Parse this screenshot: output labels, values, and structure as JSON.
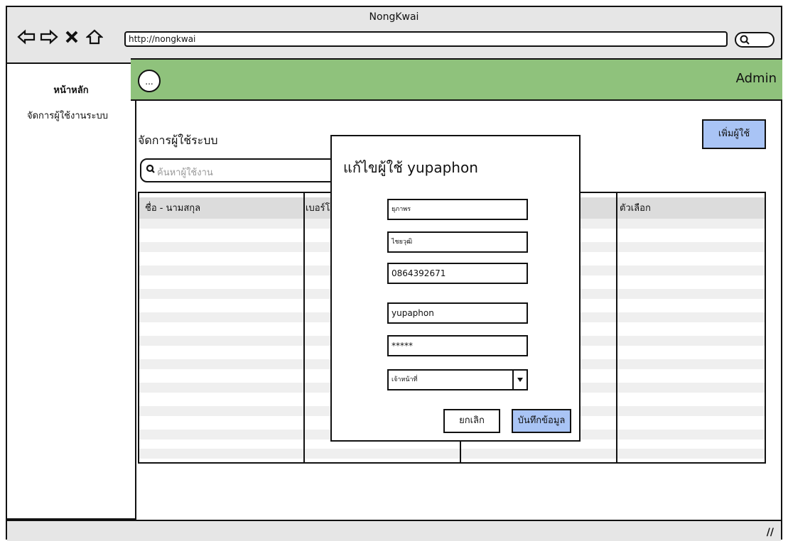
{
  "window": {
    "title": "NongKwai"
  },
  "browser": {
    "url": "http://nongkwai"
  },
  "sidebar": {
    "items": [
      {
        "label": "หน้าหลัก"
      },
      {
        "label": "จัดการผู้ใช้งานระบบ"
      }
    ]
  },
  "topbar": {
    "menu_label": "...",
    "user": "Admin",
    "color": "#8fc27c"
  },
  "page": {
    "title": "จัดการผู้ใช้ระบบ",
    "add_button": "เพิ่มผู้ใช้",
    "search_placeholder": "ค้นหาผู้ใช้งาน"
  },
  "table": {
    "headers": [
      "ชื่อ - นามสกุล",
      "เบอร์โท",
      "ตัวเลือก"
    ]
  },
  "dialog": {
    "title": "แก้ไขผู้ใช้ yupaphon",
    "fields": [
      "ยุภาพร",
      "ไชยวุฒิ",
      "0864392671",
      "yupaphon",
      "*****"
    ],
    "role_select": "เจ้าหน้าที่",
    "cancel_button": "ยกเลิก",
    "save_button": "บันทึกข้อมูล"
  },
  "colors": {
    "accent_blue": "#a9c4f5",
    "header_green": "#8fc27c"
  }
}
